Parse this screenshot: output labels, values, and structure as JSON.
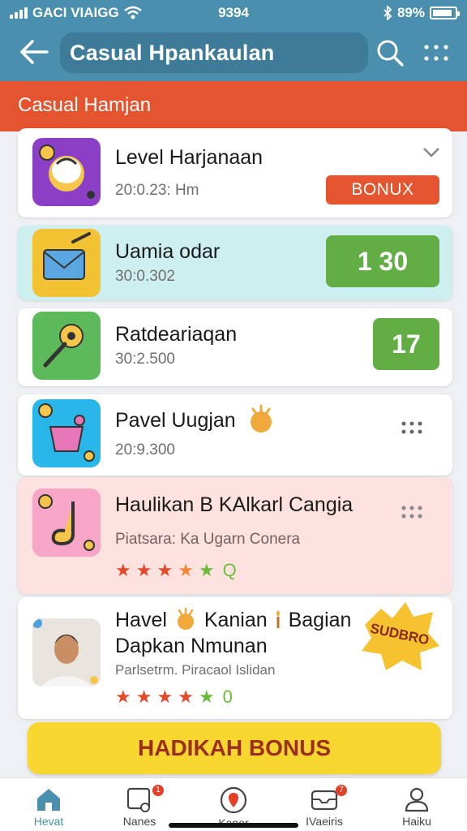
{
  "status_bar": {
    "carrier": "GACI VIAIGG",
    "time": "9394",
    "battery": "89%",
    "battery_level": 0.89
  },
  "header": {
    "title": "Casual Hpankaulan",
    "icons": [
      "arrow-left-icon",
      "search-icon",
      "more-grid-icon"
    ]
  },
  "banner": {
    "label": "Casual Hamjan"
  },
  "items": [
    {
      "title": "Level Harjanaan",
      "subtitle": "20:0.23: Hm",
      "action": "BONUX",
      "icon": "teapot-icon",
      "thumb_color": "#8b3fc7"
    },
    {
      "title": "Uamia odar",
      "subtitle": "30:0.302",
      "score": "1  30",
      "icon": "envelope-icon",
      "thumb_color": "#f2c233"
    },
    {
      "title": "Ratdeariaqan",
      "subtitle": "30:2.500",
      "score": "17",
      "icon": "key-icon",
      "thumb_color": "#5cba5a"
    },
    {
      "title": "Pavel Uugjan",
      "subtitle": "20:9.300",
      "icon": "basket-icon",
      "thumb_color": "#29b6e8"
    },
    {
      "title": "Haulikan B KAlkarl Cangia",
      "subtitle": "Piatsara: Ka Ugarn Conera",
      "rating_text": "Q",
      "rating": 4,
      "icon": "music-note-icon",
      "thumb_color": "#f7a6c8"
    },
    {
      "title_line1": "Havel",
      "title_mid": "Kanian",
      "title_end": "Bagian",
      "title_line2": "Dapkan Nmunan",
      "subtitle": "Parlsetrm. Piracaol Islidan",
      "rating_text": "0",
      "rating": 4,
      "badge": "SUDBRO",
      "icon": "avatar-photo"
    }
  ],
  "cta": {
    "label": "HADIKAH BONUS"
  },
  "bottom_nav": [
    {
      "label": "Hevat",
      "icon": "home-icon",
      "active": true
    },
    {
      "label": "Nanes",
      "icon": "device-icon",
      "badge": "1"
    },
    {
      "label": "Kanor",
      "icon": "location-icon"
    },
    {
      "label": "IVaeiris",
      "icon": "inbox-icon",
      "badge": "7"
    },
    {
      "label": "Haiku",
      "icon": "person-icon"
    }
  ],
  "colors": {
    "header": "#4a8fae",
    "banner": "#e3542f",
    "score_green": "#62ae45",
    "cta_yellow": "#f7d630",
    "highlight_blue": "#cdeff0",
    "highlight_pink": "#fde2e0"
  }
}
